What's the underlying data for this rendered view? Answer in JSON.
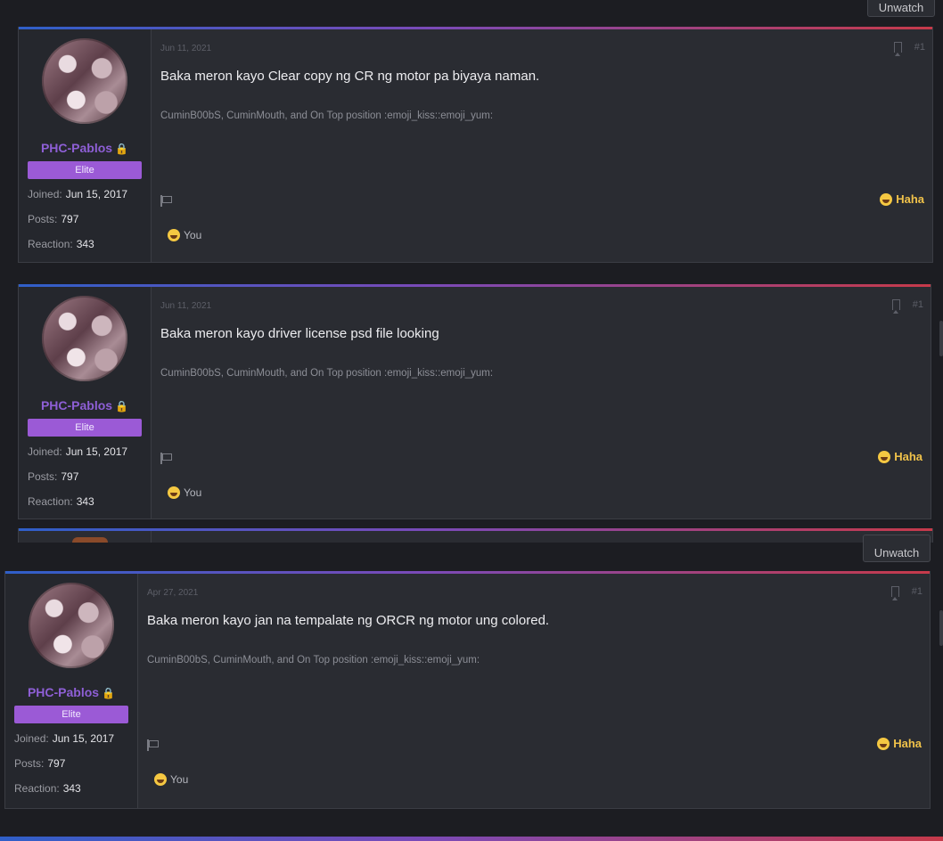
{
  "header": {
    "unwatch_label": "Unwatch"
  },
  "posts": [
    {
      "user": {
        "name": "PHC-Pablos",
        "banner": "Elite",
        "joined_label": "Joined:",
        "joined_value": "Jun 15, 2017",
        "posts_label": "Posts:",
        "posts_value": "797",
        "reaction_label": "Reaction:",
        "reaction_value": "343"
      },
      "date": "Jun 11, 2021",
      "number": "#1",
      "message": "Baka meron kayo Clear copy ng CR ng motor pa biyaya naman.",
      "signature": "CuminB00bS, CuminMouth, and On Top position :emoji_kiss::emoji_yum:",
      "reaction_label": "Haha",
      "reacted_by": "You"
    },
    {
      "user": {
        "name": "PHC-Pablos",
        "banner": "Elite",
        "joined_label": "Joined:",
        "joined_value": "Jun 15, 2017",
        "posts_label": "Posts:",
        "posts_value": "797",
        "reaction_label": "Reaction:",
        "reaction_value": "343"
      },
      "date": "Jun 11, 2021",
      "number": "#1",
      "message": "Baka meron kayo driver license psd file looking",
      "signature": "CuminB00bS, CuminMouth, and On Top position :emoji_kiss::emoji_yum:",
      "reaction_label": "Haha",
      "reacted_by": "You"
    },
    {
      "user": {
        "name": "PHC-Pablos",
        "banner": "Elite",
        "joined_label": "Joined:",
        "joined_value": "Jun 15, 2017",
        "posts_label": "Posts:",
        "posts_value": "797",
        "reaction_label": "Reaction:",
        "reaction_value": "343"
      },
      "date": "Apr 27, 2021",
      "number": "#1",
      "message": "Baka meron kayo jan na tempalate ng ORCR ng motor ung colored.",
      "signature": "CuminB00bS, CuminMouth, and On Top position :emoji_kiss::emoji_yum:",
      "reaction_label": "Haha",
      "reacted_by": "You"
    }
  ],
  "colors": {
    "accent_gradient": [
      "#2f5fc8",
      "#7a4ab8",
      "#c63a4a"
    ],
    "username": "#8e5fd6",
    "banner": "#9b5ad6",
    "haha": "#f0c24a"
  },
  "icons": [
    "lock-icon",
    "bookmark-icon",
    "flag-icon",
    "haha-emoji-icon"
  ]
}
